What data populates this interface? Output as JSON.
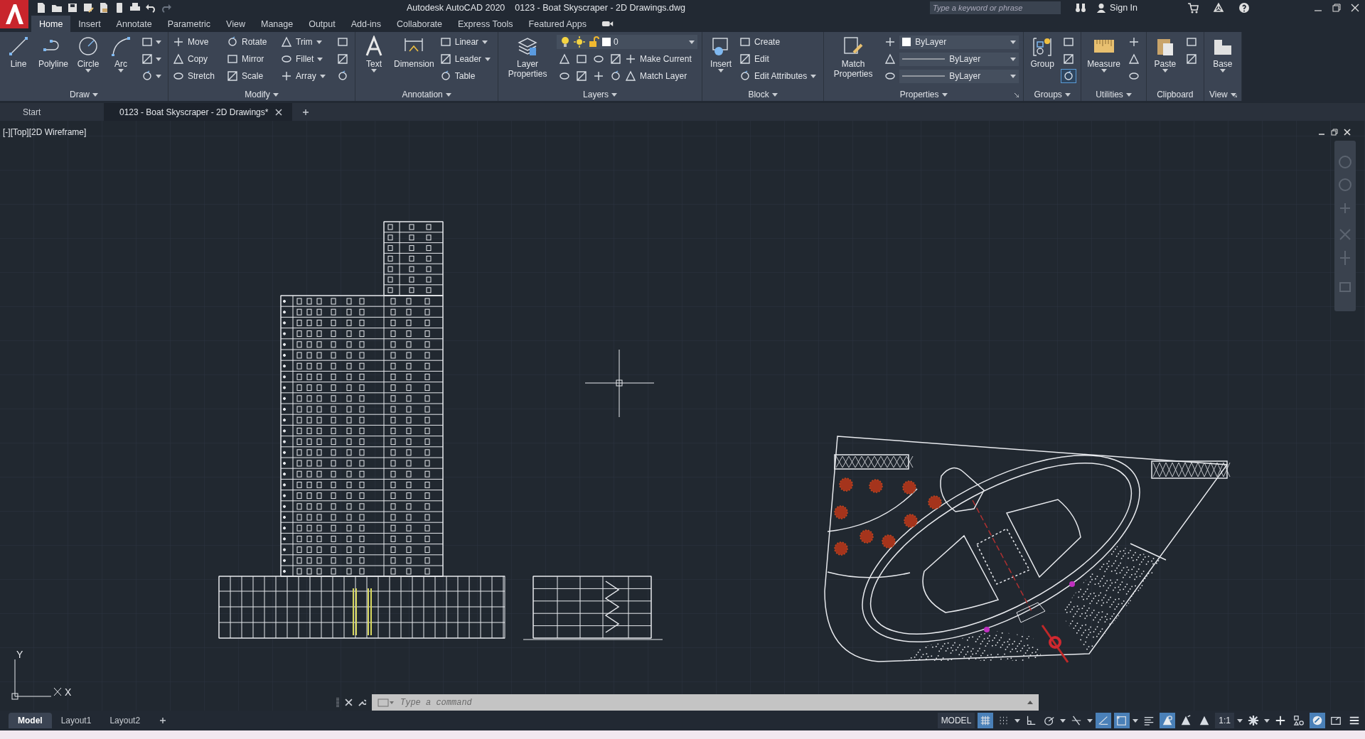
{
  "title_bar": {
    "app_title": "Autodesk AutoCAD 2020",
    "file_title": "0123 - Boat Skyscraper - 2D Drawings.dwg",
    "search": {
      "placeholder": "Type a keyword or phrase"
    },
    "sign_in": "Sign In"
  },
  "ribbon_tabs": [
    {
      "label": "Home",
      "selected": true
    },
    {
      "label": "Insert",
      "selected": false
    },
    {
      "label": "Annotate",
      "selected": false
    },
    {
      "label": "Parametric",
      "selected": false
    },
    {
      "label": "View",
      "selected": false
    },
    {
      "label": "Manage",
      "selected": false
    },
    {
      "label": "Output",
      "selected": false
    },
    {
      "label": "Add-ins",
      "selected": false
    },
    {
      "label": "Collaborate",
      "selected": false
    },
    {
      "label": "Express Tools",
      "selected": false
    },
    {
      "label": "Featured Apps",
      "selected": false
    }
  ],
  "ribbon_panels": [
    {
      "title": "Draw",
      "dropdown": true,
      "launcher": false,
      "large": [
        {
          "label": "Line",
          "dropdown": false
        },
        {
          "label": "Polyline",
          "dropdown": false
        },
        {
          "label": "Circle",
          "dropdown": true
        },
        {
          "label": "Arc",
          "dropdown": true
        }
      ],
      "rows": [
        [
          {
            "kind": "icon",
            "dropdown": true
          }
        ],
        [
          {
            "kind": "icon",
            "dropdown": true
          }
        ],
        [
          {
            "kind": "icon",
            "dropdown": true
          }
        ]
      ]
    },
    {
      "title": "Modify",
      "dropdown": true,
      "launcher": false,
      "rows": [
        [
          {
            "kind": "tool",
            "label": "Move",
            "dropdown": false
          },
          {
            "kind": "tool",
            "label": "Rotate",
            "dropdown": false
          },
          {
            "kind": "tool",
            "label": "Trim",
            "dropdown": true
          },
          {
            "kind": "icon",
            "dropdown": false
          }
        ],
        [
          {
            "kind": "tool",
            "label": "Copy",
            "dropdown": false
          },
          {
            "kind": "tool",
            "label": "Mirror",
            "dropdown": false
          },
          {
            "kind": "tool",
            "label": "Fillet",
            "dropdown": true
          },
          {
            "kind": "icon",
            "dropdown": false
          }
        ],
        [
          {
            "kind": "tool",
            "label": "Stretch",
            "dropdown": false
          },
          {
            "kind": "tool",
            "label": "Scale",
            "dropdown": false
          },
          {
            "kind": "tool",
            "label": "Array",
            "dropdown": true
          },
          {
            "kind": "icon",
            "dropdown": false
          }
        ]
      ]
    },
    {
      "title": "Annotation",
      "dropdown": true,
      "launcher": false,
      "large": [
        {
          "label": "Text",
          "dropdown": true
        },
        {
          "label": "Dimension",
          "dropdown": false
        }
      ],
      "rows": [
        [
          {
            "kind": "tool",
            "label": "Linear",
            "dropdown": true
          }
        ],
        [
          {
            "kind": "tool",
            "label": "Leader",
            "dropdown": true
          }
        ],
        [
          {
            "kind": "tool",
            "label": "Table",
            "dropdown": false
          }
        ]
      ]
    },
    {
      "title": "Layers",
      "dropdown": true,
      "launcher": false,
      "large": [
        {
          "label": "Layer Properties",
          "dropdown": false
        }
      ],
      "rows": [
        [
          {
            "kind": "layer_select",
            "value": "0"
          }
        ],
        [
          {
            "kind": "icon",
            "dropdown": false
          },
          {
            "kind": "icon",
            "dropdown": false
          },
          {
            "kind": "icon",
            "dropdown": false
          },
          {
            "kind": "icon",
            "dropdown": false
          },
          {
            "kind": "tool",
            "label": "Make Current",
            "dropdown": false
          }
        ],
        [
          {
            "kind": "icon",
            "dropdown": false
          },
          {
            "kind": "icon",
            "dropdown": false
          },
          {
            "kind": "icon",
            "dropdown": false
          },
          {
            "kind": "icon",
            "dropdown": false
          },
          {
            "kind": "tool",
            "label": "Match Layer",
            "dropdown": false
          }
        ]
      ]
    },
    {
      "title": "Block",
      "dropdown": true,
      "launcher": false,
      "large": [
        {
          "label": "Insert",
          "dropdown": true
        }
      ],
      "rows": [
        [
          {
            "kind": "tool",
            "label": "Create",
            "dropdown": false
          }
        ],
        [
          {
            "kind": "tool",
            "label": "Edit",
            "dropdown": false
          }
        ],
        [
          {
            "kind": "tool",
            "label": "Edit Attributes",
            "dropdown": true
          }
        ]
      ]
    },
    {
      "title": "Properties",
      "dropdown": true,
      "launcher": true,
      "large": [
        {
          "label": "Match Properties",
          "dropdown": false
        }
      ],
      "rows": [
        [
          {
            "kind": "icon",
            "dropdown": false
          },
          {
            "kind": "select",
            "value": "ByLayer",
            "swatch": true
          }
        ],
        [
          {
            "kind": "icon",
            "dropdown": false
          },
          {
            "kind": "select",
            "value": "ByLayer",
            "swatch": false
          }
        ],
        [
          {
            "kind": "icon",
            "dropdown": false
          },
          {
            "kind": "select",
            "value": "ByLayer",
            "swatch": false
          }
        ]
      ]
    },
    {
      "title": "Groups",
      "dropdown": true,
      "launcher": false,
      "large": [
        {
          "label": "Group",
          "dropdown": false
        }
      ],
      "rows": [
        [
          {
            "kind": "icon",
            "dropdown": false,
            "active": false
          }
        ],
        [
          {
            "kind": "icon",
            "dropdown": false,
            "active": false
          }
        ],
        [
          {
            "kind": "icon",
            "dropdown": false,
            "active": true
          }
        ]
      ]
    },
    {
      "title": "Utilities",
      "dropdown": true,
      "launcher": false,
      "large": [
        {
          "label": "Measure",
          "dropdown": true
        }
      ],
      "rows": [
        [
          {
            "kind": "icon",
            "dropdown": false
          }
        ],
        [
          {
            "kind": "icon",
            "dropdown": false
          }
        ],
        [
          {
            "kind": "icon",
            "dropdown": false
          }
        ]
      ]
    },
    {
      "title": "Clipboard",
      "dropdown": false,
      "launcher": false,
      "large": [
        {
          "label": "Paste",
          "dropdown": true
        }
      ],
      "rows": [
        [
          {
            "kind": "icon",
            "dropdown": false
          }
        ],
        [
          {
            "kind": "icon",
            "dropdown": false
          }
        ]
      ]
    },
    {
      "title": "View",
      "dropdown": true,
      "launcher": true,
      "large": [
        {
          "label": "Base",
          "dropdown": true
        }
      ]
    }
  ],
  "file_tabs": [
    {
      "label": "Start",
      "selected": false,
      "closable": false
    },
    {
      "label": "0123 - Boat Skyscraper - 2D Drawings*",
      "selected": true,
      "closable": true
    }
  ],
  "viewport": {
    "label": "[-][Top][2D Wireframe]",
    "ucs_y": "Y",
    "ucs_x": "X"
  },
  "command_line": {
    "placeholder": "Type a command"
  },
  "layout_tabs": [
    {
      "label": "Model",
      "selected": true
    },
    {
      "label": "Layout1",
      "selected": false
    },
    {
      "label": "Layout2",
      "selected": false
    }
  ],
  "status_bar": [
    {
      "kind": "label",
      "label": "MODEL"
    },
    {
      "kind": "toggle",
      "on": true
    },
    {
      "kind": "toggle",
      "on": false
    },
    {
      "kind": "caret"
    },
    {
      "kind": "toggle",
      "on": false
    },
    {
      "kind": "toggle",
      "on": false
    },
    {
      "kind": "caret"
    },
    {
      "kind": "toggle",
      "on": false
    },
    {
      "kind": "caret"
    },
    {
      "kind": "toggle",
      "on": true
    },
    {
      "kind": "toggle",
      "on": true
    },
    {
      "kind": "caret"
    },
    {
      "kind": "toggle",
      "on": false
    },
    {
      "kind": "toggle",
      "on": true
    },
    {
      "kind": "toggle",
      "on": false
    },
    {
      "kind": "toggle",
      "on": false
    },
    {
      "kind": "label",
      "label": "1:1"
    },
    {
      "kind": "caret"
    },
    {
      "kind": "toggle",
      "on": false
    },
    {
      "kind": "caret"
    },
    {
      "kind": "toggle",
      "on": false
    },
    {
      "kind": "toggle",
      "on": false
    },
    {
      "kind": "toggle",
      "on": true
    },
    {
      "kind": "toggle",
      "on": false
    },
    {
      "kind": "toggle",
      "on": false
    }
  ]
}
